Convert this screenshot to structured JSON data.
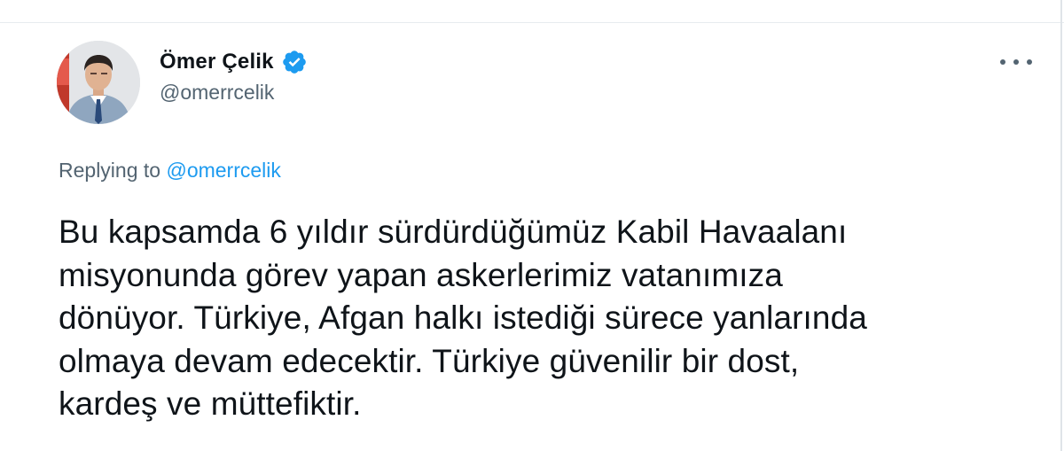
{
  "tweet": {
    "author": {
      "name": "Ömer Çelik",
      "handle": "@omerrcelik",
      "verified": true,
      "verified_color": "#1d9bf0"
    },
    "more_menu_icon": "more-horizontal-icon",
    "replying": {
      "prefix": "Replying to ",
      "mention": "@omerrcelik"
    },
    "text_lines": [
      "Bu kapsamda 6 yıldır sürdürdüğümüz Kabil Havaalanı",
      "misyonunda görev yapan askerlerimiz vatanımıza",
      "dönüyor. Türkiye, Afgan halkı istediği sürece yanlarında",
      "olmaya devam edecektir. Türkiye güvenilir bir dost,",
      "kardeş ve müttefiktir."
    ]
  },
  "colors": {
    "text_primary": "#0f1419",
    "text_secondary": "#536471",
    "link": "#1d9bf0",
    "divider": "#e7ecef"
  }
}
